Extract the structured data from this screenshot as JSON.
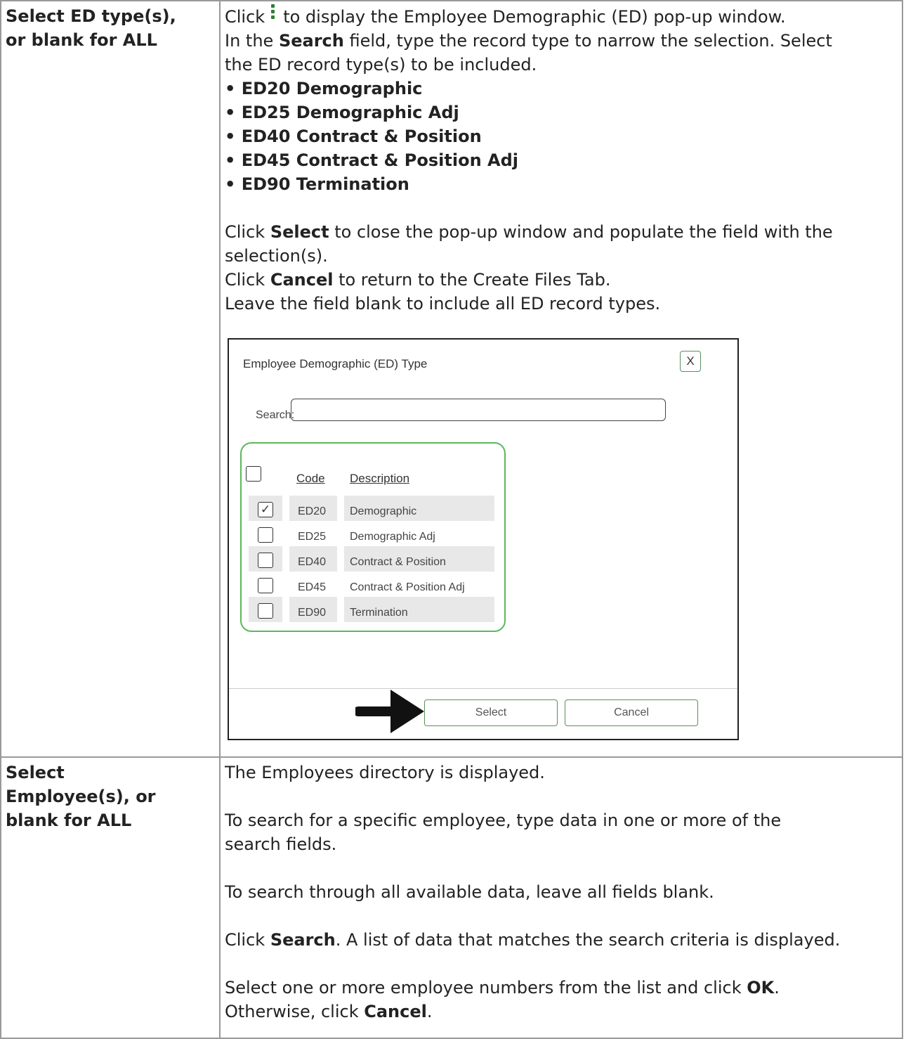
{
  "row1": {
    "label_line1": "Select ED type(s),",
    "label_line2": "or blank for ALL",
    "p1_a": "Click",
    "p1_b": "to display the Employee Demographic (ED) pop-up window.",
    "p2_a": "In the ",
    "p2_bold": "Search",
    "p2_b": " field, type the record type to narrow the selection. Select",
    "p2_c": "the ED record type(s) to be included.",
    "bullets": [
      "• ED20 Demographic",
      "• ED25 Demographic Adj",
      "• ED40 Contract & Position",
      "• ED45 Contract & Position Adj",
      "• ED90 Termination"
    ],
    "p3_a": "Click ",
    "p3_bold": "Select",
    "p3_b": " to close the pop-up window and populate the field with the",
    "p3_c": "selection(s).",
    "p4_a": "Click ",
    "p4_bold": "Cancel",
    "p4_b": " to return to the Create Files Tab.",
    "p5": "Leave the field blank to include all ED record types."
  },
  "dialog": {
    "title": "Employee Demographic (ED) Type",
    "close_label": "X",
    "search_label": "Search:",
    "search_value": "",
    "header_code": "Code",
    "header_description": "Description",
    "rows": [
      {
        "code": "ED20",
        "description": "Demographic",
        "checked": true
      },
      {
        "code": "ED25",
        "description": "Demographic Adj",
        "checked": false
      },
      {
        "code": "ED40",
        "description": "Contract & Position",
        "checked": false
      },
      {
        "code": "ED45",
        "description": "Contract & Position Adj",
        "checked": false
      },
      {
        "code": "ED90",
        "description": "Termination",
        "checked": false
      }
    ],
    "select_label": "Select",
    "cancel_label": "Cancel"
  },
  "row2": {
    "label_line1": "Select",
    "label_line2": "Employee(s), or",
    "label_line3": "blank for ALL",
    "p1": "The Employees directory is displayed.",
    "p2_a": "To search for a specific employee, type data in one or more of the",
    "p2_b": "search fields.",
    "p3": "To search through all available data, leave all fields blank.",
    "p4_a": "Click ",
    "p4_bold": "Search",
    "p4_b": ". A list of data that matches the search criteria is displayed.",
    "p5_a": "Select one or more employee numbers from the list and click ",
    "p5_bold": "OK",
    "p5_b": ".",
    "p6_a": "Otherwise, click ",
    "p6_bold": "Cancel",
    "p6_b": "."
  },
  "colors": {
    "border": "#999999",
    "kebab_icon": "#2e7d32",
    "grid_outline": "#5cb85c"
  }
}
